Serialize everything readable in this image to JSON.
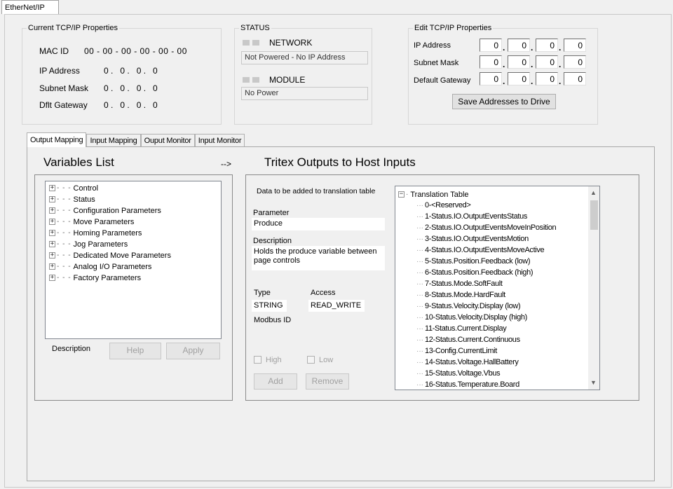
{
  "top_tab": {
    "label": "EtherNet/IP"
  },
  "current_props": {
    "legend": "Current TCP/IP Properties",
    "mac_label": "MAC ID",
    "mac_value": "00 -  00 -  00 -  00 -  00 -  00",
    "ip_label": "IP Address",
    "ip_value": "0 .   0 .   0 .   0",
    "subnet_label": "Subnet Mask",
    "subnet_value": "0 .   0 .   0 .   0",
    "gateway_label": "Dflt Gateway",
    "gateway_value": "0 .   0 .   0 .   0"
  },
  "status": {
    "legend": "STATUS",
    "network_label": "NETWORK",
    "network_value": "Not Powered - No IP Address",
    "module_label": "MODULE",
    "module_value": "No Power"
  },
  "edit_props": {
    "legend": "Edit TCP/IP Properties",
    "ip_label": "IP Address",
    "subnet_label": "Subnet Mask",
    "gateway_label": "Default Gateway",
    "ip": [
      "0",
      "0",
      "0",
      "0"
    ],
    "subnet": [
      "0",
      "0",
      "0",
      "0"
    ],
    "gateway": [
      "0",
      "0",
      "0",
      "0"
    ],
    "save_button": "Save Addresses to Drive"
  },
  "tabs": [
    "Output Mapping",
    "Input Mapping",
    "Ouput Monitor",
    "Input Monitor"
  ],
  "variables": {
    "title": "Variables List",
    "arrow": "-->",
    "items": [
      "Control",
      "Status",
      "Configuration Parameters",
      "Move Parameters",
      "Homing Parameters",
      "Jog Parameters",
      "Dedicated Move Parameters",
      "Analog I/O Parameters",
      "Factory Parameters"
    ],
    "description_label": "Description",
    "help_button": "Help",
    "apply_button": "Apply"
  },
  "outputs": {
    "title": "Tritex Outputs to Host Inputs",
    "data_header": "Data to be added to translation table",
    "parameter_label": "Parameter",
    "parameter_value": "Produce",
    "description_label": "Description",
    "description_value": "Holds the produce variable between page controls",
    "type_label": "Type",
    "type_value": "STRING",
    "access_label": "Access",
    "access_value": "READ_WRITE",
    "modbus_label": "Modbus ID",
    "high_label": "High",
    "low_label": "Low",
    "add_button": "Add",
    "remove_button": "Remove"
  },
  "translation": {
    "root": "Translation Table",
    "items": [
      "0-<Reserved>",
      "1-Status.IO.OutputEventsStatus",
      "2-Status.IO.OutputEventsMoveInPosition",
      "3-Status.IO.OutputEventsMotion",
      "4-Status.IO.OutputEventsMoveActive",
      "5-Status.Position.Feedback (low)",
      "6-Status.Position.Feedback (high)",
      "7-Status.Mode.SoftFault",
      "8-Status.Mode.HardFault",
      "9-Status.Velocity.Display (low)",
      "10-Status.Velocity.Display (high)",
      "11-Status.Current.Display",
      "12-Status.Current.Continuous",
      "13-Config.CurrentLimit",
      "14-Status.Voltage.HallBattery",
      "15-Status.Voltage.Vbus",
      "16-Status.Temperature.Board"
    ]
  }
}
